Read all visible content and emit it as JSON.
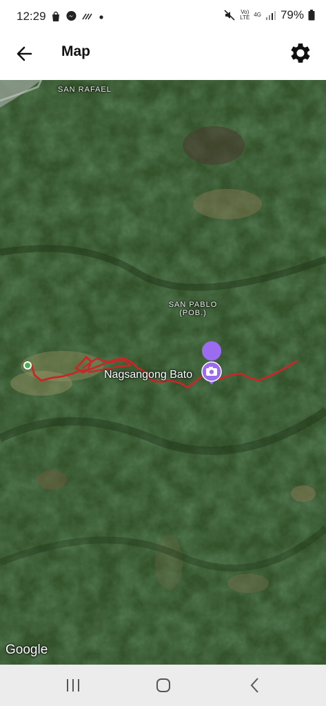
{
  "status_bar": {
    "time": "12:29",
    "volte_label": "Vo)\nLTE",
    "network_label": "4G",
    "battery": "79%",
    "icons": [
      "bag-icon",
      "messenger-icon",
      "activity-icon",
      "dot-icon",
      "mute-icon",
      "signal-icon",
      "battery-icon"
    ]
  },
  "app_bar": {
    "title": "Map",
    "icons": [
      "back-arrow-icon",
      "gear-icon"
    ]
  },
  "map": {
    "labels": {
      "san_rafael": "SAN RAFAEL",
      "san_pablo_line1": "SAN PABLO",
      "san_pablo_line2": "(POB.)"
    },
    "poi": {
      "name": "Nagsangong Bato",
      "icon": "camera-pin-icon",
      "color": "#9b6cf0"
    },
    "route_color": "#c62828",
    "start_marker_color": "#4caf50",
    "attribution": "Google"
  },
  "nav_bar": {
    "icons": [
      "recents-icon",
      "home-icon",
      "back-icon"
    ]
  }
}
